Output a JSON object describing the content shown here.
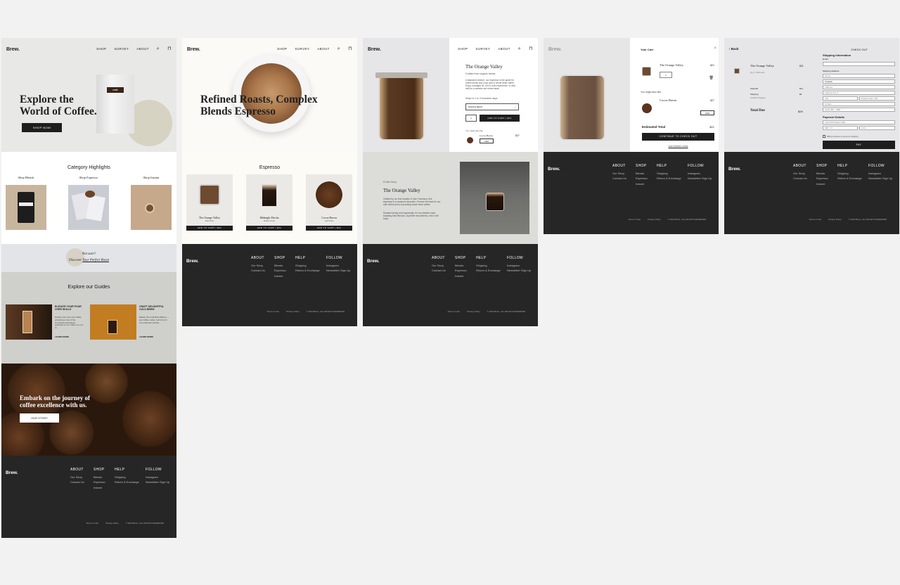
{
  "brand": {
    "logo": "Brew.",
    "accent": "#1e1e1e",
    "bg": "#f2f2f2",
    "footer_bg": "#262626"
  },
  "nav": {
    "shop": "SHOP",
    "survey": "SURVEY",
    "about": "ABOUT",
    "search_icon": "search-icon",
    "bag_icon": "bag-icon"
  },
  "home": {
    "hero_title_line1": "Explore the",
    "hero_title_line2": "World of Coffee.",
    "hero_button": "SHOP NOW",
    "bag_label": "cafe",
    "categories_title": "Category Highlights",
    "cat1": "Shop Blends",
    "cat2": "Shop Espresso",
    "cat3": "Shop Instant",
    "survey_q": "Not sure?",
    "survey_link_prefix": "Discover",
    "survey_link": "Your Perfect Roast",
    "guides_title": "Explore our Guides",
    "guide1_title": "ELEVATE YOUR POUR OVER SKILLS",
    "guide1_text": "Perfect your pour-over skills, unlocking a cup of the smoothest techniques practiced at our coffee our mix to.",
    "guide1_link": "LEARN MORE",
    "guide2_title": "CRAFT DELIGHTFUL COLD BREW",
    "guide2_text": "Master the Cold Brew Basics — just coffee, water, and time for our preferred method.",
    "guide2_link": "LEARN MORE",
    "banner_line1": "Embark on the journey of",
    "banner_line2": "coffee excellence with us.",
    "banner_button": "OUR STORY"
  },
  "espresso_page": {
    "hero_line1": "Refined Roasts, Complex",
    "hero_line2": "Blends Espresso",
    "section_title": "Espresso",
    "products": [
      {
        "name": "The Orange Valley",
        "sub": "Dark Roast",
        "button": "ADD TO CART | $21"
      },
      {
        "name": "Midnight Mocha",
        "sub": "Medium Roast",
        "button": "ADD TO CART | $21"
      },
      {
        "name": "Cocoa Haven",
        "sub": "Light Roast",
        "button": "ADD TO CART | $21"
      }
    ]
  },
  "product_page": {
    "name": "The Orange Valley",
    "origin": "Crafted from organic beans",
    "desc": "A balanced mixture, our espresso is the guide for coffee drinks and a top pick in whole bean coffee. Enjoy a straight fix, a rich, bold experience, or add milk for a sweeter yet robust taste.",
    "ships": "Ships in 1 to 3 business days",
    "grind_select": "WHOLE BEAN",
    "qty": "1",
    "add_button": "ADD TO CART | $21",
    "might_like": "You might also like",
    "rec_name": "Cocoa Haven",
    "rec_price": "$27",
    "rec_add": "ADD",
    "story_label": "Profile Story",
    "story_title": "The Orange Valley",
    "story_p1": "Crafted by our first location in San Francisco, this espresso is a customer favourite. It forms the base for our café drinks and a top-selling whole bean coffee.",
    "story_p2": "Roasted slowly and organically, for our darkest roast, boasting bold flavours, supreme smoothness, and a rich body."
  },
  "cart": {
    "title": "Your Cart",
    "close": "×",
    "item_name": "The Orange Valley",
    "item_price": "$21",
    "item_qty": "1",
    "might_like": "You might also like",
    "rec_name": "Cocoa Haven",
    "rec_price": "$27",
    "rec_add": "ADD",
    "total_label": "Estimated Total",
    "total_value": "$21",
    "checkout_button": "CONTINUE TO CHECK OUT",
    "promo_link": "ADD PROMO CODE"
  },
  "checkout": {
    "back": "Back",
    "title": "CHECK OUT",
    "shipping_info": "Shipping Information",
    "email_label": "Email",
    "shipping_address": "Shipping Address",
    "name_ph": "Name",
    "country": "Canada",
    "address_ph": "Address",
    "address2_ph": "Address line 2",
    "city_ph": "City",
    "postal_ph": "Postal Code / ZIP",
    "province": "Ontario",
    "phone_ph": "(123) 456 - 7890",
    "payment_title": "Payment Details",
    "card_ph": "1234 5678 9012 3456",
    "exp_ph": "MM / YY",
    "cvc_ph": "CVC",
    "billing_note": "Billing checkout is same as shipping",
    "pay_button": "PAY",
    "summary_item": "The Orange Valley",
    "summary_item_sub": "Qty 1 | $20 each",
    "summary_item_price": "$21",
    "subtotal_label": "Subtotal",
    "subtotal_value": "$21",
    "shipping_label": "Shipping",
    "shipping_sub": "Standard Shipping",
    "shipping_value": "$5",
    "total_label": "Total Due",
    "total_value": "$26"
  },
  "footer": {
    "logo": "Brew.",
    "about": "ABOUT",
    "about_l1": "Our Story",
    "about_l2": "Contact Us",
    "shop": "SHOP",
    "shop_l1": "Blends",
    "shop_l2": "Espresso",
    "shop_l3": "Instant",
    "help": "HELP",
    "help_l1": "Shipping",
    "help_l2": "Return & Exchange",
    "follow": "FOLLOW",
    "follow_l1": "Instagram",
    "follow_l2": "Newsletter Sign Up",
    "terms": "Terms of Use",
    "privacy": "Privacy Policy",
    "copyright": "© 2023 Brew., ALL RIGHTS RESERVED"
  }
}
